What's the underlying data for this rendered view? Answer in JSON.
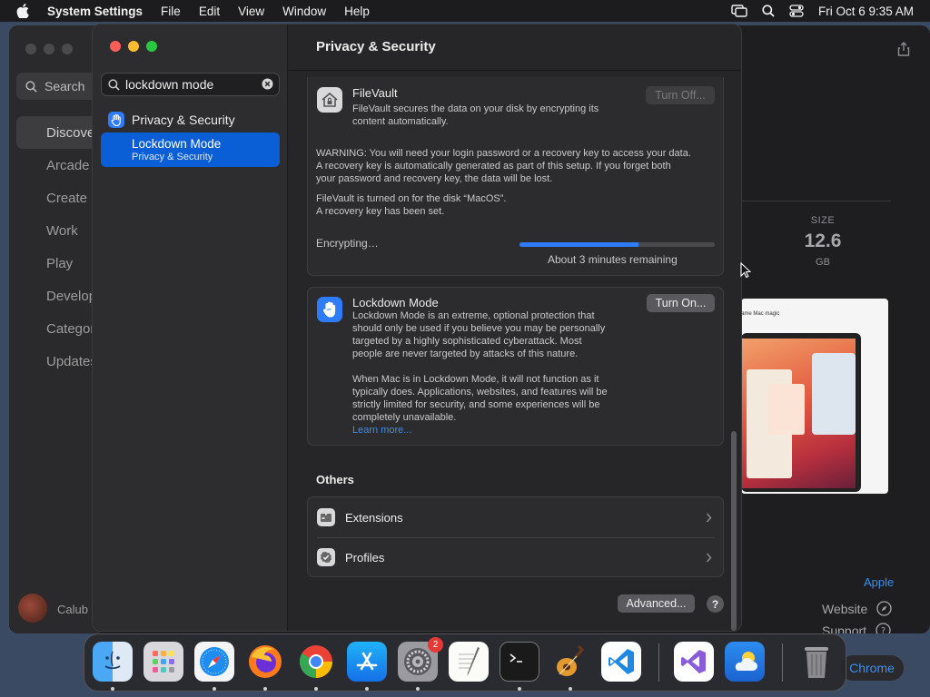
{
  "menubar": {
    "app_name": "System Settings",
    "items": [
      "File",
      "Edit",
      "View",
      "Window"
    ],
    "help": "Help",
    "clock": "Fri Oct 6  9:35 AM"
  },
  "appstore": {
    "search_label": "Search",
    "nav": [
      "Discover",
      "Arcade",
      "Create",
      "Work",
      "Play",
      "Develop",
      "Categories",
      "Updates"
    ],
    "user": "Calub",
    "size_label": "SIZE",
    "size_value": "12.6",
    "size_unit": "GB",
    "promo_caption": "ame Mac magic",
    "developer_link": "Apple",
    "website_label": "Website",
    "support_label": "Support"
  },
  "settings": {
    "search_value": "lockdown mode",
    "sidebar": {
      "group": "Privacy & Security",
      "selected_title": "Lockdown Mode",
      "selected_sub": "Privacy & Security"
    },
    "title": "Privacy & Security",
    "filevault": {
      "title": "FileVault",
      "desc1": "FileVault secures the data on your disk by encrypting its",
      "desc2": "content automatically.",
      "button": "Turn Off...",
      "warn1": "WARNING: You will need your login password or a recovery key to access your data.",
      "warn2": "A recovery key is automatically generated as part of this setup. If you forget both",
      "warn3": "your password and recovery key, the data will be lost.",
      "status1": "FileVault is turned on for the disk “MacOS”.",
      "status2": "A recovery key has been set.",
      "encrypting": "Encrypting…",
      "progress_percent": 61,
      "remaining": "About 3 minutes remaining"
    },
    "lockdown": {
      "title": "Lockdown Mode",
      "button": "Turn On...",
      "p1": [
        "Lockdown Mode is an extreme, optional protection that",
        "should only be used if you believe you may be personally",
        "targeted by a highly sophisticated cyberattack. Most",
        "people are never targeted by attacks of this nature."
      ],
      "p2": [
        "When Mac is in Lockdown Mode, it will not function as it",
        "typically does. Applications, websites, and features will be",
        "strictly limited for security, and some experiences will be",
        "completely unavailable."
      ],
      "learn_more": "Learn more..."
    },
    "others_heading": "Others",
    "others": [
      "Extensions",
      "Profiles"
    ],
    "advanced": "Advanced...",
    "help": "?"
  },
  "dock": {
    "badge_settings": "2",
    "chrome_chip": "Chrome"
  },
  "colors": {
    "accent": "#0a5fd6",
    "link": "#3a8eed",
    "close": "#ff5f57",
    "minimize": "#febc2e",
    "zoom": "#28c840"
  }
}
